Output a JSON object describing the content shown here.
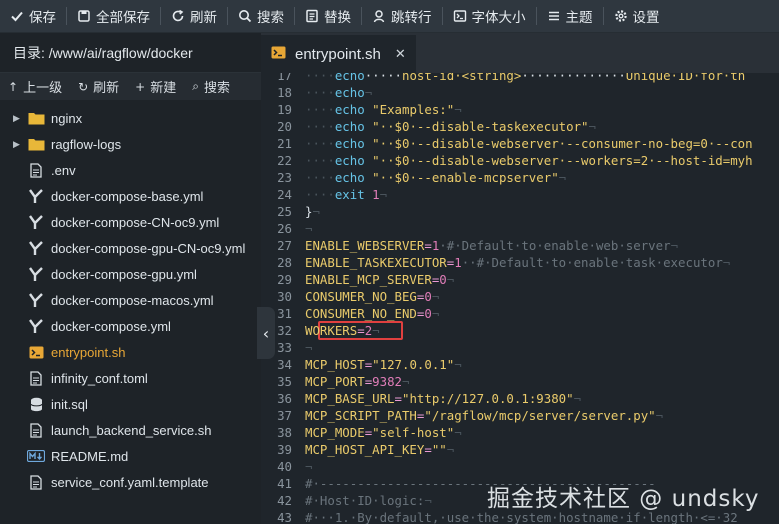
{
  "toolbar": {
    "items": [
      {
        "label": "保存",
        "icon": "check-icon"
      },
      {
        "label": "全部保存",
        "icon": "save-all-icon"
      },
      {
        "label": "刷新",
        "icon": "refresh-icon"
      },
      {
        "label": "搜索",
        "icon": "search-icon"
      },
      {
        "label": "替换",
        "icon": "replace-icon"
      },
      {
        "label": "跳转行",
        "icon": "goto-line-icon"
      },
      {
        "label": "字体大小",
        "icon": "font-size-icon"
      },
      {
        "label": "主题",
        "icon": "theme-icon"
      },
      {
        "label": "设置",
        "icon": "gear-icon"
      }
    ]
  },
  "sidebar": {
    "directory_label": "目录: /www/ai/ragflow/docker",
    "tools": {
      "up": "上一级",
      "refresh": "刷新",
      "new": "新建",
      "search": "搜索"
    },
    "files": [
      {
        "name": "nginx",
        "type": "folder"
      },
      {
        "name": "ragflow-logs",
        "type": "folder"
      },
      {
        "name": ".env",
        "type": "file"
      },
      {
        "name": "docker-compose-base.yml",
        "type": "yaml"
      },
      {
        "name": "docker-compose-CN-oc9.yml",
        "type": "yaml"
      },
      {
        "name": "docker-compose-gpu-CN-oc9.yml",
        "type": "yaml"
      },
      {
        "name": "docker-compose-gpu.yml",
        "type": "yaml"
      },
      {
        "name": "docker-compose-macos.yml",
        "type": "yaml"
      },
      {
        "name": "docker-compose.yml",
        "type": "yaml"
      },
      {
        "name": "entrypoint.sh",
        "type": "shell",
        "active": true
      },
      {
        "name": "infinity_conf.toml",
        "type": "file"
      },
      {
        "name": "init.sql",
        "type": "db"
      },
      {
        "name": "launch_backend_service.sh",
        "type": "file"
      },
      {
        "name": "README.md",
        "type": "markdown"
      },
      {
        "name": "service_conf.yaml.template",
        "type": "file"
      }
    ]
  },
  "editor": {
    "tab_label": "entrypoint.sh",
    "tab_close": "✕",
    "highlighted_line": 32,
    "lines": [
      {
        "n": "17",
        "t": [
          [
            "ws",
            "····"
          ],
          [
            "cmd",
            "echo"
          ],
          [
            "tx",
            "·····"
          ],
          [
            "str",
            "host-id·<string>"
          ],
          [
            "tx",
            "··············"
          ],
          [
            "str",
            "Unique·ID·for·th"
          ]
        ]
      },
      {
        "n": "18",
        "t": [
          [
            "ws",
            "····"
          ],
          [
            "cmd",
            "echo"
          ],
          [
            "ws",
            "¬"
          ]
        ]
      },
      {
        "n": "19",
        "t": [
          [
            "ws",
            "····"
          ],
          [
            "cmd",
            "echo"
          ],
          [
            "tx",
            " "
          ],
          [
            "str",
            "\"Examples:\""
          ],
          [
            "ws",
            "¬"
          ]
        ]
      },
      {
        "n": "20",
        "t": [
          [
            "ws",
            "····"
          ],
          [
            "cmd",
            "echo"
          ],
          [
            "tx",
            " "
          ],
          [
            "str",
            "\"··$0·--disable-taskexecutor\""
          ],
          [
            "ws",
            "¬"
          ]
        ]
      },
      {
        "n": "21",
        "t": [
          [
            "ws",
            "····"
          ],
          [
            "cmd",
            "echo"
          ],
          [
            "tx",
            " "
          ],
          [
            "str",
            "\"··$0·--disable-webserver·--consumer-no-beg=0·--con"
          ]
        ]
      },
      {
        "n": "22",
        "t": [
          [
            "ws",
            "····"
          ],
          [
            "cmd",
            "echo"
          ],
          [
            "tx",
            " "
          ],
          [
            "str",
            "\"··$0·--disable-webserver·--workers=2·--host-id=myh"
          ]
        ]
      },
      {
        "n": "23",
        "t": [
          [
            "ws",
            "····"
          ],
          [
            "cmd",
            "echo"
          ],
          [
            "tx",
            " "
          ],
          [
            "str",
            "\"··$0·--enable-mcpserver\""
          ],
          [
            "ws",
            "¬"
          ]
        ]
      },
      {
        "n": "24",
        "t": [
          [
            "ws",
            "····"
          ],
          [
            "cmd",
            "exit"
          ],
          [
            "tx",
            " "
          ],
          [
            "num",
            "1"
          ],
          [
            "ws",
            "¬"
          ]
        ]
      },
      {
        "n": "25",
        "t": [
          [
            "tx",
            "}"
          ],
          [
            "ws",
            "¬"
          ]
        ]
      },
      {
        "n": "26",
        "t": [
          [
            "ws",
            "¬"
          ]
        ]
      },
      {
        "n": "27",
        "t": [
          [
            "str",
            "ENABLE_WEBSERVER"
          ],
          [
            "var",
            "="
          ],
          [
            "num",
            "1"
          ],
          [
            "cmt",
            "·#·Default·to·enable·web·server"
          ],
          [
            "ws",
            "¬"
          ]
        ]
      },
      {
        "n": "28",
        "t": [
          [
            "str",
            "ENABLE_TASKEXECUTOR"
          ],
          [
            "var",
            "="
          ],
          [
            "num",
            "1"
          ],
          [
            "cmt",
            "··#·Default·to·enable·task·executor"
          ],
          [
            "ws",
            "¬"
          ]
        ]
      },
      {
        "n": "29",
        "t": [
          [
            "str",
            "ENABLE_MCP_SERVER"
          ],
          [
            "var",
            "="
          ],
          [
            "num",
            "0"
          ],
          [
            "ws",
            "¬"
          ]
        ]
      },
      {
        "n": "30",
        "t": [
          [
            "str",
            "CONSUMER_NO_BEG"
          ],
          [
            "var",
            "="
          ],
          [
            "num",
            "0"
          ],
          [
            "ws",
            "¬"
          ]
        ]
      },
      {
        "n": "31",
        "t": [
          [
            "str",
            "CONSUMER_NO_END"
          ],
          [
            "var",
            "="
          ],
          [
            "num",
            "0"
          ],
          [
            "ws",
            "¬"
          ]
        ]
      },
      {
        "n": "32",
        "t": [
          [
            "str",
            "WORKERS"
          ],
          [
            "var",
            "="
          ],
          [
            "num",
            "2"
          ],
          [
            "ws",
            "¬"
          ]
        ]
      },
      {
        "n": "33",
        "t": [
          [
            "ws",
            "¬"
          ]
        ]
      },
      {
        "n": "34",
        "t": [
          [
            "str",
            "MCP_HOST"
          ],
          [
            "var",
            "="
          ],
          [
            "str",
            "\"127.0.0.1\""
          ],
          [
            "ws",
            "¬"
          ]
        ]
      },
      {
        "n": "35",
        "t": [
          [
            "str",
            "MCP_PORT"
          ],
          [
            "var",
            "="
          ],
          [
            "num",
            "9382"
          ],
          [
            "ws",
            "¬"
          ]
        ]
      },
      {
        "n": "36",
        "t": [
          [
            "str",
            "MCP_BASE_URL"
          ],
          [
            "var",
            "="
          ],
          [
            "str",
            "\"http://127.0.0.1:9380\""
          ],
          [
            "ws",
            "¬"
          ]
        ]
      },
      {
        "n": "37",
        "t": [
          [
            "str",
            "MCP_SCRIPT_PATH"
          ],
          [
            "var",
            "="
          ],
          [
            "str",
            "\"/ragflow/mcp/server/server.py\""
          ],
          [
            "ws",
            "¬"
          ]
        ]
      },
      {
        "n": "38",
        "t": [
          [
            "str",
            "MCP_MODE"
          ],
          [
            "var",
            "="
          ],
          [
            "str",
            "\"self-host\""
          ],
          [
            "ws",
            "¬"
          ]
        ]
      },
      {
        "n": "39",
        "t": [
          [
            "str",
            "MCP_HOST_API_KEY"
          ],
          [
            "var",
            "="
          ],
          [
            "str",
            "\"\""
          ],
          [
            "ws",
            "¬"
          ]
        ]
      },
      {
        "n": "40",
        "t": [
          [
            "ws",
            "¬"
          ]
        ]
      },
      {
        "n": "41",
        "t": [
          [
            "cmt",
            "#·---------------------------------------------"
          ]
        ]
      },
      {
        "n": "42",
        "t": [
          [
            "cmt",
            "#·Host·ID·logic:"
          ],
          [
            "ws",
            "¬"
          ]
        ]
      },
      {
        "n": "43",
        "t": [
          [
            "cmt",
            "#···1.·By·default,·use·the·system·hostname·if·length·<=·32"
          ]
        ]
      }
    ]
  },
  "watermark": "掘金技术社区 @ undsky",
  "colors": {
    "accent_active_file": "#e8a736",
    "highlight_box": "#e0403f",
    "folder_yellow": "#e8b739",
    "toolbar_bg": "#2f373f",
    "editor_bg": "#1f252b"
  }
}
